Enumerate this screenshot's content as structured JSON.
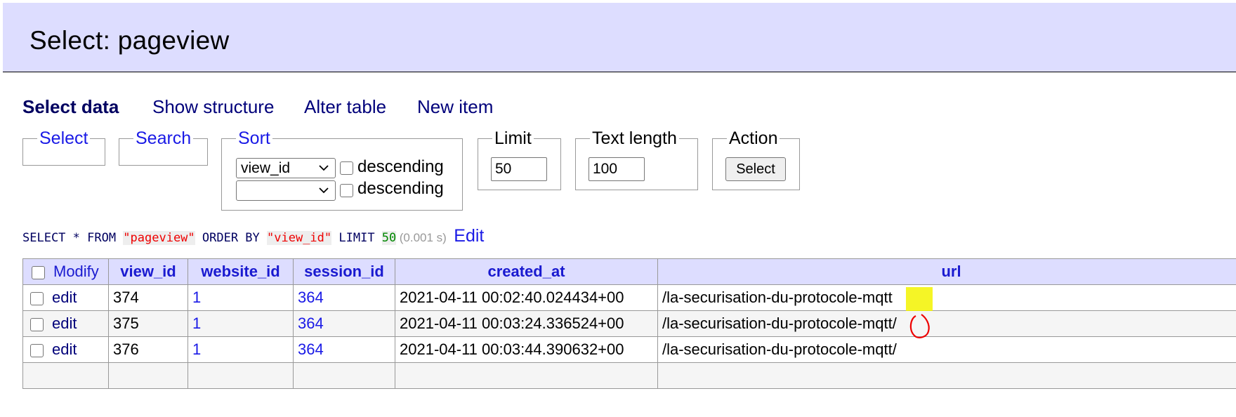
{
  "header": {
    "title": "Select: pageview"
  },
  "tabs": [
    {
      "label": "Select data",
      "active": true
    },
    {
      "label": "Show structure"
    },
    {
      "label": "Alter table"
    },
    {
      "label": "New item"
    }
  ],
  "fieldsets": {
    "select": {
      "legend": "Select"
    },
    "search": {
      "legend": "Search"
    },
    "sort": {
      "legend": "Sort",
      "rows": [
        {
          "column": "view_id",
          "descending_label": "descending",
          "descending_checked": false
        },
        {
          "column": "",
          "descending_label": "descending",
          "descending_checked": false
        }
      ]
    },
    "limit": {
      "legend": "Limit",
      "value": "50"
    },
    "text_length": {
      "legend": "Text length",
      "value": "100"
    },
    "action": {
      "legend": "Action",
      "button_label": "Select"
    }
  },
  "query": {
    "p1": "SELECT * FROM ",
    "table": "\"pageview\"",
    "p2": " ORDER BY ",
    "col": "\"view_id\"",
    "p3": " LIMIT ",
    "limit": "50",
    "time": "(0.001 s)",
    "edit_label": "Edit"
  },
  "table": {
    "modify_label": "Modify",
    "columns": [
      "view_id",
      "website_id",
      "session_id",
      "created_at",
      "url"
    ],
    "rows": [
      {
        "edit": "edit",
        "view_id": "374",
        "website_id": "1",
        "session_id": "364",
        "created_at": "2021-04-11 00:02:40.024434+00",
        "url": "/la-securisation-du-protocole-mqtt"
      },
      {
        "edit": "edit",
        "view_id": "375",
        "website_id": "1",
        "session_id": "364",
        "created_at": "2021-04-11 00:03:24.336524+00",
        "url": "/la-securisation-du-protocole-mqtt/"
      },
      {
        "edit": "edit",
        "view_id": "376",
        "website_id": "1",
        "session_id": "364",
        "created_at": "2021-04-11 00:03:44.390632+00",
        "url": "/la-securisation-du-protocole-mqtt/"
      }
    ]
  },
  "colors": {
    "header_bg": "#ddf",
    "link": "#1a1ae6",
    "highlight": "#f3f300",
    "annotation": "#e00"
  },
  "icons": [
    "chevron-down-icon",
    "checkbox-icon"
  ]
}
